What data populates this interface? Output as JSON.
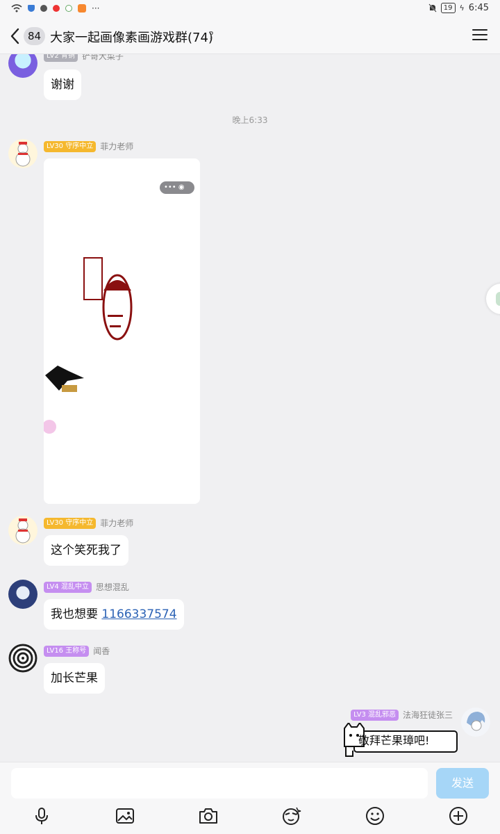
{
  "status_bar": {
    "time": "6:45",
    "battery": "19"
  },
  "header": {
    "unread_count": "84",
    "group_title": "大家一起画像素画游戏群(74)",
    "help_glyph": "?"
  },
  "messages": [
    {
      "level": "LV2 青铜",
      "name": "铲哥大菜子",
      "text": "谢谢"
    },
    {
      "time_divider": "晚上6:33"
    },
    {
      "level": "LV30 守序中立",
      "name": "菲力老师",
      "mini_ctl": "•••  ◉"
    },
    {
      "level": "LV30 守序中立",
      "name": "菲力老师",
      "text": "这个笑死我了"
    },
    {
      "level": "LV4 混乱中立",
      "name": "思想混乱",
      "text": "我也想要 ",
      "link": "1166337574"
    },
    {
      "level": "LV16 王称号",
      "name": "闻香",
      "text": "加长芒果"
    },
    {
      "level": "LV3 混乱邪恶",
      "name": "法海狂徒张三",
      "text": "敬拜芒果璋吧!"
    }
  ],
  "input": {
    "placeholder": "",
    "send_label": "发送"
  },
  "toolbar_icons": [
    "mic-icon",
    "image-icon",
    "camera-icon",
    "sticker-icon",
    "emoji-icon",
    "plus-icon"
  ]
}
